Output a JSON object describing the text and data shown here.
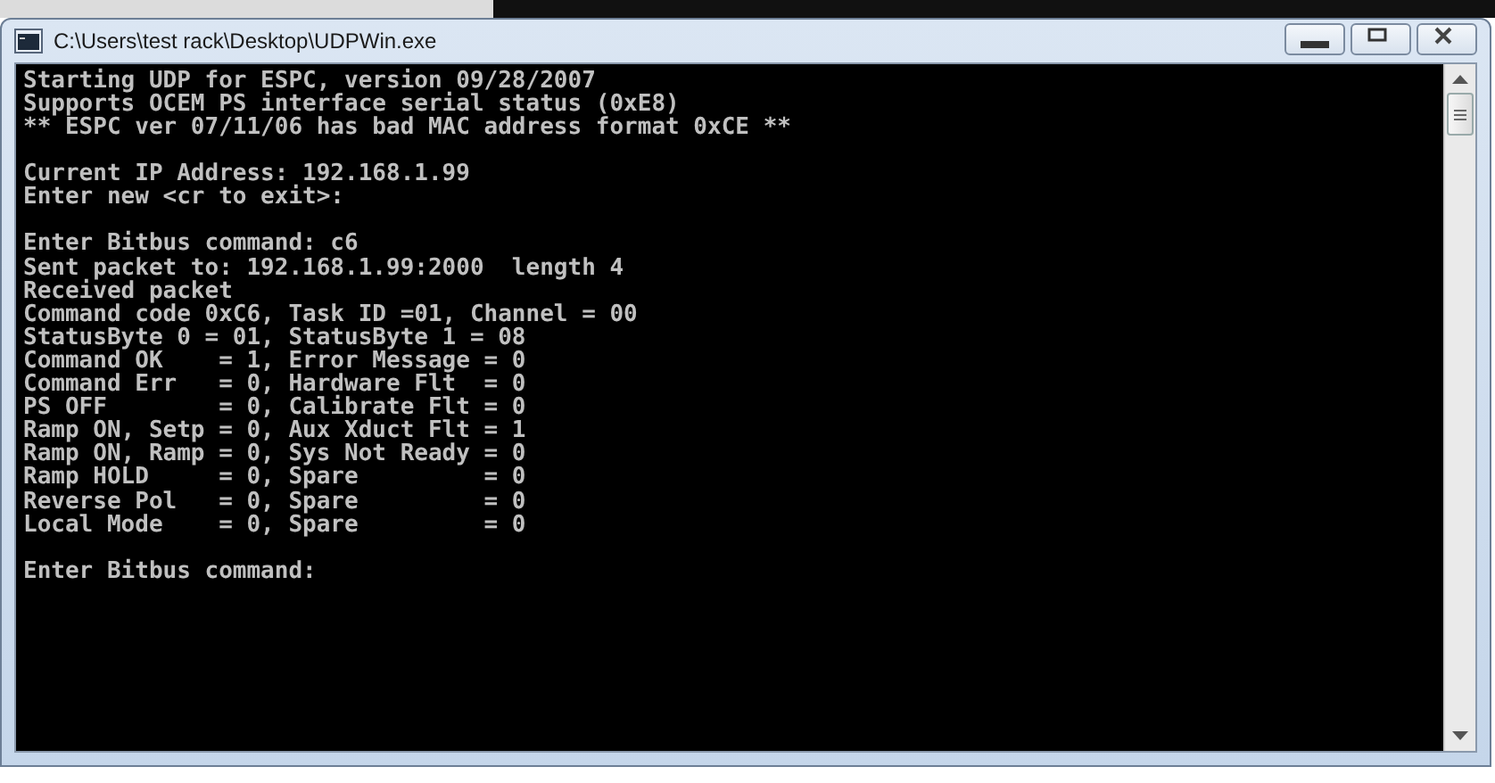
{
  "window": {
    "title": "C:\\Users\\test rack\\Desktop\\UDPWin.exe"
  },
  "console": {
    "blocks": [
      [
        "Starting UDP for ESPC, version 09/28/2007",
        "Supports OCEM PS interface serial status (0xE8)",
        "** ESPC ver 07/11/06 has bad MAC address format 0xCE **"
      ],
      [
        "Current IP Address: 192.168.1.99",
        "Enter new <cr to exit>:"
      ],
      [
        "Enter Bitbus command: c6",
        "Sent packet to: 192.168.1.99:2000  length 4",
        "Received packet",
        "Command code 0xC6, Task ID =01, Channel = 00",
        "StatusByte 0 = 01, StatusByte 1 = 08",
        "Command OK    = 1, Error Message = 0",
        "Command Err   = 0, Hardware Flt  = 0",
        "PS OFF        = 0, Calibrate Flt = 0",
        "Ramp ON, Setp = 0, Aux Xduct Flt = 1",
        "Ramp ON, Ramp = 0, Sys Not Ready = 0",
        "Ramp HOLD     = 0, Spare         = 0",
        "Reverse Pol   = 0, Spare         = 0",
        "Local Mode    = 0, Spare         = 0"
      ],
      [
        "Enter Bitbus command:"
      ]
    ]
  }
}
